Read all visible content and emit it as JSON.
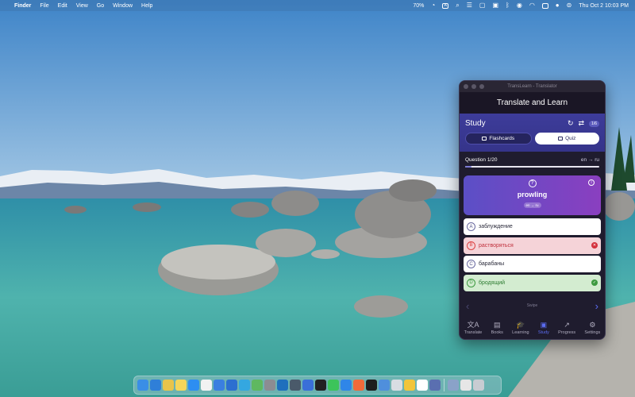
{
  "menubar": {
    "apple_symbol": "",
    "items": [
      "Finder",
      "File",
      "Edit",
      "View",
      "Go",
      "Window",
      "Help"
    ],
    "battery_text": "70%",
    "keyboard_label": "A",
    "datetime": "Thu Oct 2  10:03 PM"
  },
  "window": {
    "title": "TransLearn - Translator",
    "header": "Translate and Learn"
  },
  "study": {
    "title": "Study",
    "count_badge": "1/6",
    "modes": [
      {
        "label": "Flashcards",
        "active": false
      },
      {
        "label": "Quiz",
        "active": true
      }
    ]
  },
  "quiz": {
    "question_label": "Question 1/20",
    "language_pair": "en → ru",
    "progress": 0.05,
    "word": "prowling",
    "word_lang": "en → ru",
    "answers": [
      {
        "letter": "A",
        "text": "заблуждение",
        "state": "neutral"
      },
      {
        "letter": "B",
        "text": "растворяться",
        "state": "wrong"
      },
      {
        "letter": "C",
        "text": "барабаны",
        "state": "neutral"
      },
      {
        "letter": "D",
        "text": "бродящий",
        "state": "correct"
      }
    ],
    "swipe_hint": "Swipe"
  },
  "tabs": [
    {
      "label": "Translate",
      "icon": "translate-icon",
      "glyph": "文A",
      "active": false
    },
    {
      "label": "Books",
      "icon": "book-icon",
      "glyph": "▤",
      "active": false
    },
    {
      "label": "Learning",
      "icon": "graduation-cap-icon",
      "glyph": "🎓",
      "active": false
    },
    {
      "label": "Study",
      "icon": "cards-icon",
      "glyph": "▣",
      "active": true
    },
    {
      "label": "Progress",
      "icon": "trend-icon",
      "glyph": "↗",
      "active": false
    },
    {
      "label": "Settings",
      "icon": "gear-icon",
      "glyph": "⚙",
      "active": false
    }
  ],
  "colors": {
    "accent": "#5b6cf0",
    "correct": "#3d9a40",
    "wrong": "#d4313d"
  }
}
